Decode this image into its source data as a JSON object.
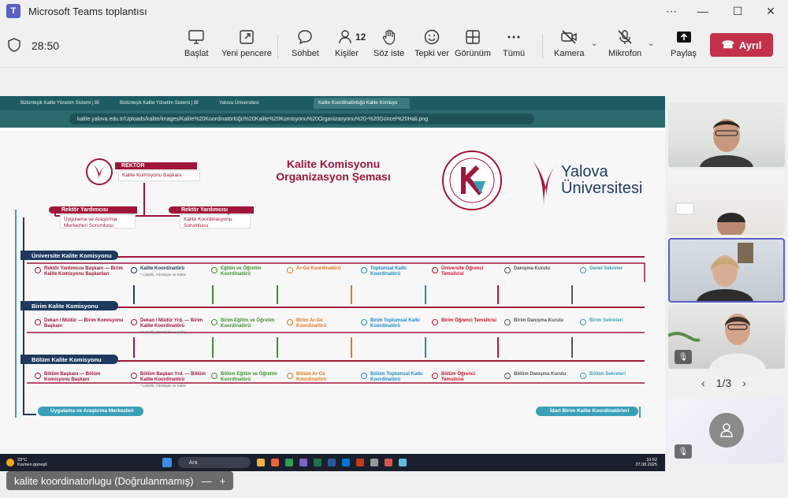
{
  "window": {
    "title": "Microsoft Teams toplantısı",
    "app_icon": "teams-icon"
  },
  "toolbar": {
    "timer": "28:50",
    "buttons": [
      {
        "label": "Başlat",
        "icon": "share-screen-icon"
      },
      {
        "label": "Yeni pencere",
        "icon": "new-window-icon"
      },
      {
        "label": "Sohbet",
        "icon": "chat-icon"
      },
      {
        "label": "Kişiler",
        "icon": "people-icon",
        "count": "12"
      },
      {
        "label": "Söz iste",
        "icon": "raise-hand-icon"
      },
      {
        "label": "Tepki ver",
        "icon": "smiley-icon"
      },
      {
        "label": "Görünüm",
        "icon": "grid-icon"
      },
      {
        "label": "Tümü",
        "icon": "more-icon"
      },
      {
        "label": "Kamera",
        "icon": "camera-off-icon"
      },
      {
        "label": "Mikrofon",
        "icon": "mic-off-icon"
      },
      {
        "label": "Paylaş",
        "icon": "share-icon"
      }
    ],
    "leave_label": "Ayrıl",
    "leave_color": "#c4314b"
  },
  "browser": {
    "tabs": [
      "Bütünleşik Kalite Yönetim Sistemi | Bİ",
      "Bütünleşik Kalite Yönetim Sistemi | Bİ",
      "Yalova Üniversitesi",
      "Kalite Koordinatörlüğü Kalite Komisyo"
    ],
    "address": "kalite.yalova.edu.tr/Uploads/kalite/images/Kalite%20Koordinatörlüğü%20Kalite%20Komisyonu%20Organizasyonu%20-%20Güncel%20Hali.png"
  },
  "diagram": {
    "title_line1": "Kalite Komisyonu",
    "title_line2": "Organizasyon Şeması",
    "university_line1": "Yalova",
    "university_line2": "Üniversitesi",
    "rektor": "REKTÖR",
    "rektor_sub": "Kalite Komisyonu Başkanı",
    "ry1": "Rektör Yardımcısı",
    "ry1_sub": "Uygulama ve Araştırma Merkezleri Sorumlusu",
    "ry2": "Rektör Yardımcısı",
    "ry2_sub": "Kalite Koordinasyonu Sorumlusu",
    "rows": [
      {
        "title": "Üniversite Kalite Komisyonu",
        "nodes": [
          {
            "text": "Rektör Yardımcısı Başkanı — Birim Kalite Komisyonu Başkanları",
            "color": "#a0163a"
          },
          {
            "text": "Kalite Koordinatörü",
            "sub": "* Liderlik, Yönetişim ve Kalite",
            "color": "#1e3a5f"
          },
          {
            "text": "Eğitim ve Öğretim Koordinatörü",
            "color": "#3f8f2f"
          },
          {
            "text": "Ar-Ge Koordinatörü",
            "color": "#e07a1f"
          },
          {
            "text": "Toplumsal Katkı Koordinatörü",
            "color": "#1e88c8"
          },
          {
            "text": "Üniversite Öğrenci Temsilcisi",
            "color": "#c8102e"
          },
          {
            "text": "Danışma Kurulu",
            "color": "#555555"
          },
          {
            "text": "Genel Sekreter",
            "color": "#3aa0b8"
          }
        ]
      },
      {
        "title": "Birim Kalite Komisyonu",
        "nodes": [
          {
            "text": "Dekan / Müdür — Birim Komisyonu Başkanı",
            "color": "#a0163a"
          },
          {
            "text": "Dekan / Müdür Yrd. — Birim Kalite Koordinatörü",
            "sub": "* Liderlik, Yönetişim ve Kalite",
            "color": "#a0163a"
          },
          {
            "text": "Birim Eğitim ve Öğretim Koordinatörü",
            "color": "#3f8f2f"
          },
          {
            "text": "Birim Ar-Ge Koordinatörü",
            "color": "#e07a1f"
          },
          {
            "text": "Birim Toplumsal Katkı Koordinatörü",
            "color": "#1e88c8"
          },
          {
            "text": "Birim Öğrenci Temsilcisi",
            "color": "#c8102e"
          },
          {
            "text": "Birim Danışma Kurulu",
            "color": "#555555"
          },
          {
            "text": "Birim Sekreteri",
            "color": "#3aa0b8"
          }
        ]
      },
      {
        "title": "Bölüm Kalite Komisyonu",
        "nodes": [
          {
            "text": "Bölüm Başkanı — Bölüm Komisyonu Başkanı",
            "color": "#a0163a"
          },
          {
            "text": "Bölüm Başkan Yrd. — Bölüm Kalite Koordinatörü",
            "sub": "* Liderlik, Yönetişim ve Kalite",
            "color": "#a0163a"
          },
          {
            "text": "Bölüm Eğitim ve Öğretim Koordinatörü",
            "color": "#3f8f2f"
          },
          {
            "text": "Bölüm Ar-Ge Koordinatörü",
            "color": "#e07a1f"
          },
          {
            "text": "Bölüm Toplumsal Katkı Koordinatörü",
            "color": "#1e88c8"
          },
          {
            "text": "Bölüm Öğrenci Temsilcisi",
            "color": "#c8102e"
          },
          {
            "text": "Bölüm Danışma Kurulu",
            "color": "#555555"
          },
          {
            "text": "Bölüm Sekreteri",
            "color": "#3aa0b8"
          }
        ]
      }
    ],
    "footer_left": "Uygulama ve Araştırma Merkezleri",
    "footer_right": "İdari Birim Kalite Koordinatörleri"
  },
  "taskbar": {
    "weather": "23°C",
    "weather_sub": "Kısmen güneşli",
    "search": "Ara",
    "time": "10:52",
    "date": "27.08.2025"
  },
  "presenter_label": "kalite koordinatorlugu (Doğrulanmamış)",
  "participants": {
    "pager": "1/3"
  }
}
